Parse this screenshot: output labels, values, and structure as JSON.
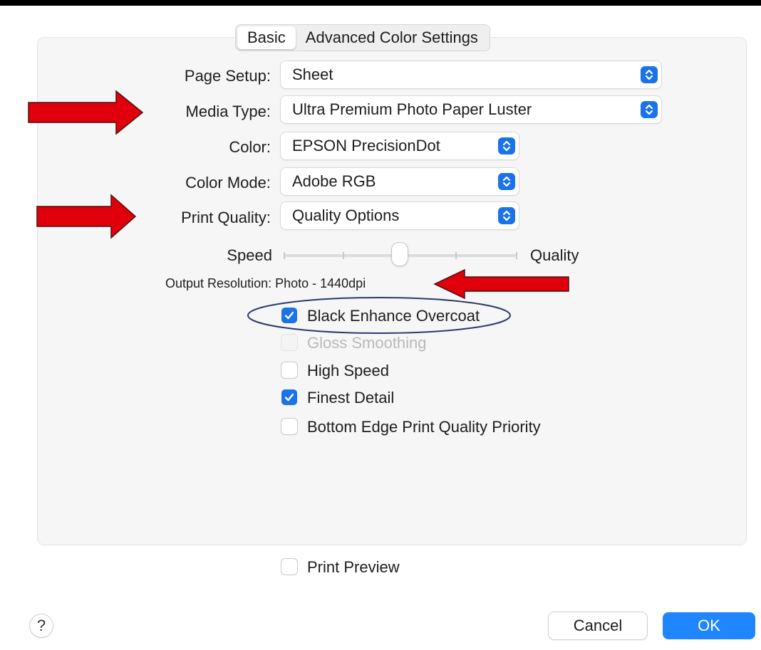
{
  "tabs": [
    "Basic",
    "Advanced Color Settings"
  ],
  "fields": {
    "page_setup": {
      "label": "Page Setup:",
      "value": "Sheet"
    },
    "media_type": {
      "label": "Media Type:",
      "value": "Ultra Premium Photo Paper Luster"
    },
    "color": {
      "label": "Color:",
      "value": "EPSON PrecisionDot"
    },
    "color_mode": {
      "label": "Color Mode:",
      "value": "Adobe RGB"
    },
    "print_quality": {
      "label": "Print Quality:",
      "value": "Quality Options"
    }
  },
  "slider": {
    "left_label": "Speed",
    "right_label": "Quality",
    "level": 0.5
  },
  "output_resolution": "Output Resolution:  Photo - 1440dpi",
  "checkboxes": [
    {
      "label": "Black Enhance Overcoat",
      "checked": true,
      "enabled": true
    },
    {
      "label": "Gloss Smoothing",
      "checked": false,
      "enabled": false
    },
    {
      "label": "High Speed",
      "checked": false,
      "enabled": true
    },
    {
      "label": "Finest Detail",
      "checked": true,
      "enabled": true
    },
    {
      "label": "Bottom Edge Print Quality Priority",
      "checked": false,
      "enabled": true
    }
  ],
  "print_preview": {
    "label": "Print Preview",
    "checked": false
  },
  "buttons": {
    "help": "?",
    "cancel": "Cancel",
    "ok": "OK"
  },
  "colors": {
    "accent": "#1a73e8",
    "annotation_red": "#e0000b",
    "annotation_ellipse": "#2b3a67"
  }
}
